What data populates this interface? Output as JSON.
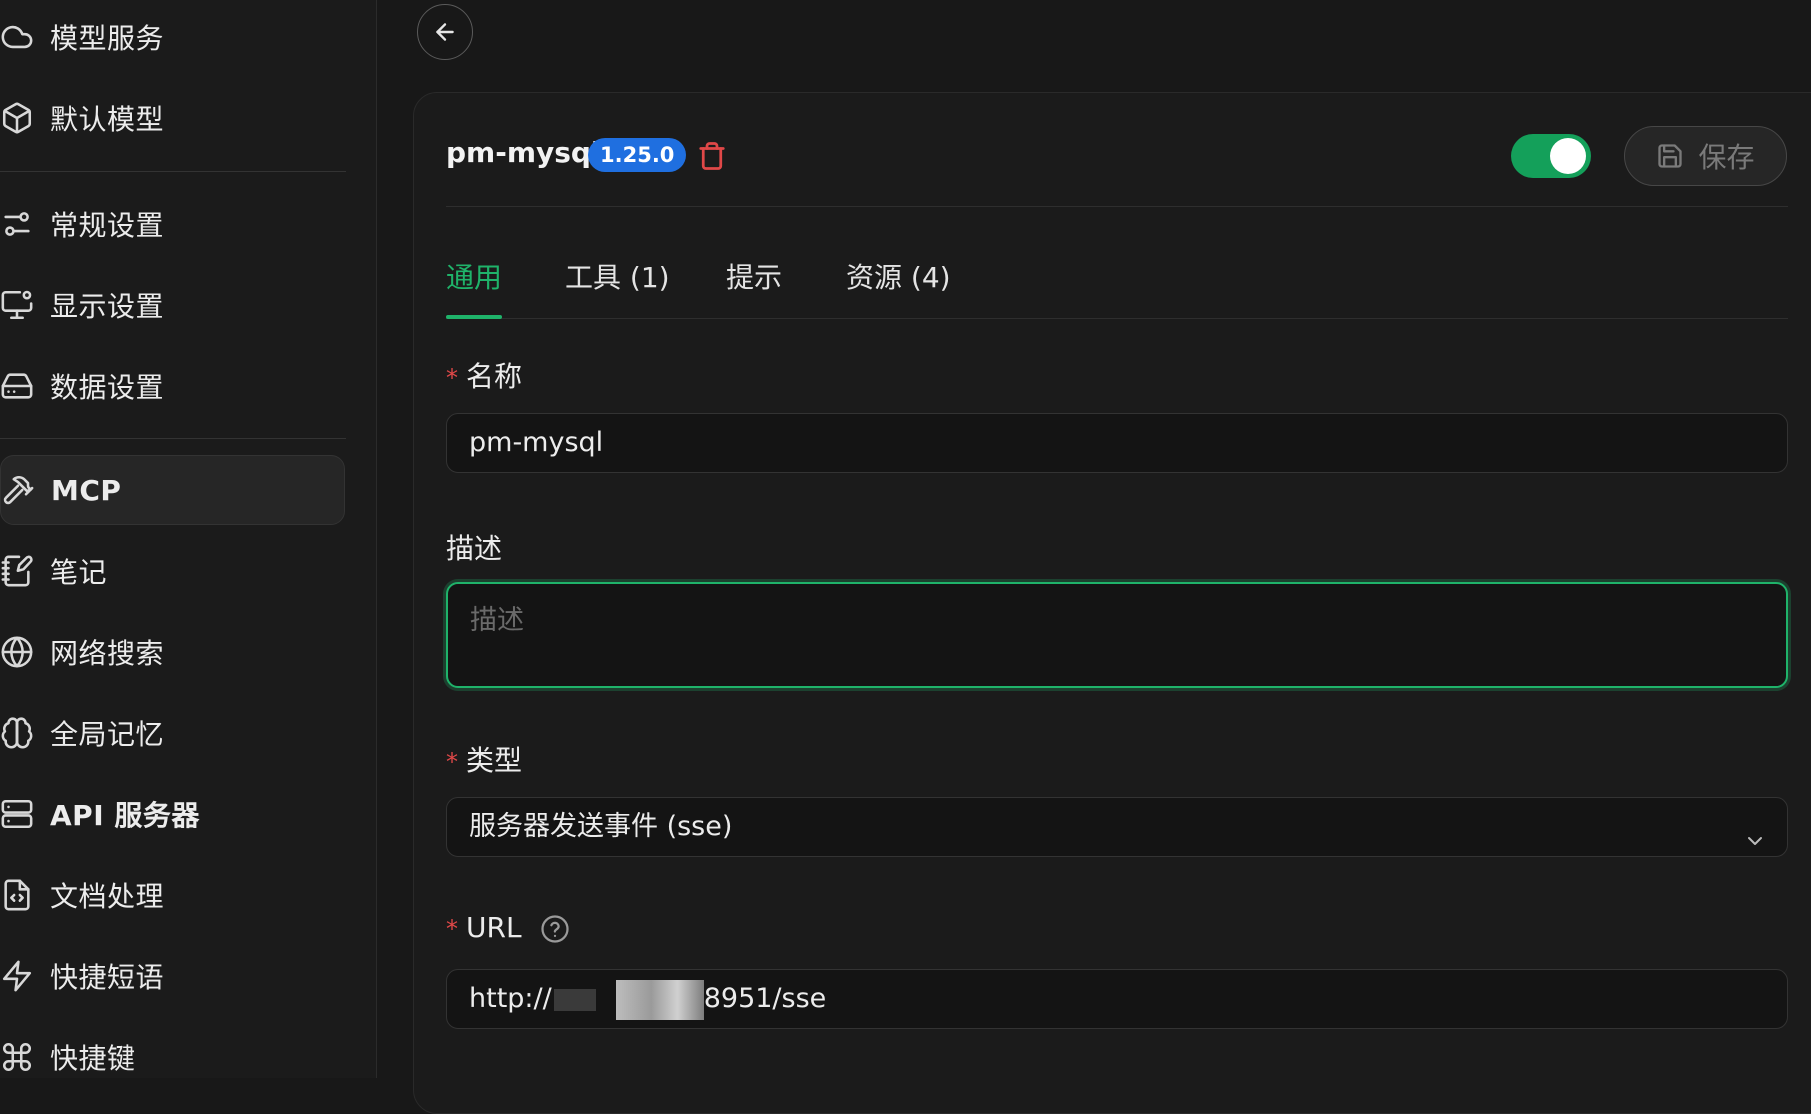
{
  "sidebar": {
    "items": [
      {
        "label": "模型服务",
        "icon": "cloud-icon"
      },
      {
        "label": "默认模型",
        "icon": "cube-icon"
      },
      {
        "label": "常规设置",
        "icon": "sliders-icon"
      },
      {
        "label": "显示设置",
        "icon": "monitor-settings-icon"
      },
      {
        "label": "数据设置",
        "icon": "hard-drive-icon"
      },
      {
        "label": "MCP",
        "icon": "hammer-icon"
      },
      {
        "label": "笔记",
        "icon": "notebook-pen-icon"
      },
      {
        "label": "网络搜索",
        "icon": "globe-icon"
      },
      {
        "label": "全局记忆",
        "icon": "brain-icon"
      },
      {
        "label": "API 服务器",
        "icon": "server-icon"
      },
      {
        "label": "文档处理",
        "icon": "file-code-icon"
      },
      {
        "label": "快捷短语",
        "icon": "zap-icon"
      },
      {
        "label": "快捷键",
        "icon": "command-icon"
      }
    ],
    "active": "MCP"
  },
  "header": {
    "server_name": "pm-mysql",
    "version": "1.25.0",
    "enabled": true,
    "save_label": "保存"
  },
  "tabs": [
    {
      "label": "通用"
    },
    {
      "label": "工具 (1)"
    },
    {
      "label": "提示"
    },
    {
      "label": "资源 (4)"
    }
  ],
  "form": {
    "name_label": "名称",
    "name_value": "pm-mysql",
    "desc_label": "描述",
    "desc_placeholder": "描述",
    "type_label": "类型",
    "type_value": "服务器发送事件 (sse)",
    "url_label": "URL",
    "url_prefix": "http://",
    "url_suffix": "8951/sse",
    "required_mark": "*"
  },
  "colors": {
    "accent": "#1fb36a",
    "badge": "#1f6fe0",
    "danger": "#e04848",
    "background": "#181818"
  }
}
